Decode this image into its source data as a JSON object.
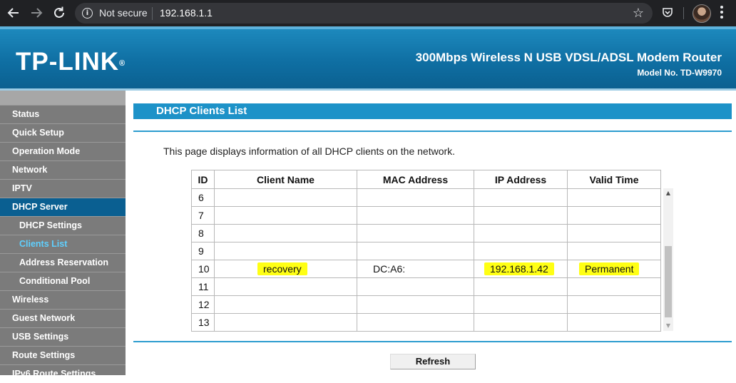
{
  "browser": {
    "security_text": "Not secure",
    "url": "192.168.1.1"
  },
  "router": {
    "brand": "TP-LINK",
    "brand_mark": "®",
    "product": "300Mbps Wireless N USB VDSL/ADSL Modem Router",
    "model": "Model No. TD-W9970"
  },
  "sidebar": {
    "items": [
      {
        "label": "Status",
        "level": 0,
        "state": "normal"
      },
      {
        "label": "Quick Setup",
        "level": 0,
        "state": "normal"
      },
      {
        "label": "Operation Mode",
        "level": 0,
        "state": "normal"
      },
      {
        "label": "Network",
        "level": 0,
        "state": "normal"
      },
      {
        "label": "IPTV",
        "level": 0,
        "state": "normal"
      },
      {
        "label": "DHCP Server",
        "level": 0,
        "state": "active"
      },
      {
        "label": "DHCP Settings",
        "level": 1,
        "state": "normal"
      },
      {
        "label": "Clients List",
        "level": 1,
        "state": "current"
      },
      {
        "label": "Address Reservation",
        "level": 1,
        "state": "normal"
      },
      {
        "label": "Conditional Pool",
        "level": 1,
        "state": "normal"
      },
      {
        "label": "Wireless",
        "level": 0,
        "state": "normal"
      },
      {
        "label": "Guest Network",
        "level": 0,
        "state": "normal"
      },
      {
        "label": "USB Settings",
        "level": 0,
        "state": "normal"
      },
      {
        "label": "Route Settings",
        "level": 0,
        "state": "normal"
      },
      {
        "label": "IPv6 Route Settings",
        "level": 0,
        "state": "normal"
      }
    ]
  },
  "main": {
    "title": "DHCP Clients List",
    "description": "This page displays information of all DHCP clients on the network.",
    "table": {
      "headers": [
        "ID",
        "Client Name",
        "MAC Address",
        "IP Address",
        "Valid Time"
      ],
      "rows": [
        {
          "id": "6",
          "name": "",
          "mac": "",
          "ip": "",
          "time": ""
        },
        {
          "id": "7",
          "name": "",
          "mac": "",
          "ip": "",
          "time": ""
        },
        {
          "id": "8",
          "name": "",
          "mac": "",
          "ip": "",
          "time": ""
        },
        {
          "id": "9",
          "name": "",
          "mac": "",
          "ip": "",
          "time": ""
        },
        {
          "id": "10",
          "name": "recovery",
          "mac": "DC:A6:",
          "ip": "192.168.1.42",
          "time": "Permanent"
        },
        {
          "id": "11",
          "name": "",
          "mac": "",
          "ip": "",
          "time": ""
        },
        {
          "id": "12",
          "name": "",
          "mac": "",
          "ip": "",
          "time": ""
        },
        {
          "id": "13",
          "name": "",
          "mac": "",
          "ip": "",
          "time": ""
        }
      ]
    },
    "refresh_label": "Refresh"
  },
  "colors": {
    "highlight": "#ffff14",
    "title_bar": "#1d92c8",
    "sidebar_active": "#0a5f91",
    "sidebar_current_text": "#5fd0ff"
  }
}
